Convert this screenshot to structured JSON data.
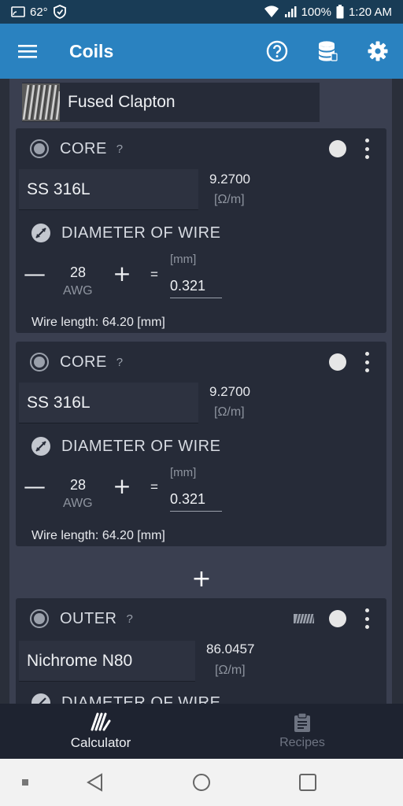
{
  "status_bar": {
    "temperature": "62°",
    "battery": "100%",
    "time": "1:20 AM"
  },
  "app_bar": {
    "title": "Coils",
    "icons": [
      "menu-icon",
      "help-icon",
      "database-icon",
      "settings-icon"
    ]
  },
  "coil": {
    "name": "Fused Clapton"
  },
  "cards": [
    {
      "type": "CORE",
      "help": "?",
      "material": "SS 316L",
      "resistance": "9.2700",
      "resistance_unit": "[Ω/m]",
      "diameter_label": "DIAMETER OF WIRE",
      "minus": "—",
      "gauge": "28",
      "gauge_unit": "AWG",
      "plus": "+",
      "equals": "=",
      "mm_unit": "[mm]",
      "mm_value": "0.321",
      "wire_length": "Wire length: 64.20 [mm]"
    },
    {
      "type": "CORE",
      "help": "?",
      "material": "SS 316L",
      "resistance": "9.2700",
      "resistance_unit": "[Ω/m]",
      "diameter_label": "DIAMETER OF WIRE",
      "minus": "—",
      "gauge": "28",
      "gauge_unit": "AWG",
      "plus": "+",
      "equals": "=",
      "mm_unit": "[mm]",
      "mm_value": "0.321",
      "wire_length": "Wire length: 64.20 [mm]"
    },
    {
      "type": "OUTER",
      "help": "?",
      "material": "Nichrome N80",
      "resistance": "86.0457",
      "resistance_unit": "[Ω/m]",
      "diameter_label": "DIAMETER OF WIRE"
    }
  ],
  "add_button": "+",
  "bottom_nav": {
    "items": [
      {
        "label": "Calculator",
        "icon": "calculator-icon",
        "active": true
      },
      {
        "label": "Recipes",
        "icon": "recipes-icon",
        "active": false
      }
    ]
  },
  "colors": {
    "app_bar": "#2a82c0",
    "status_bar": "#193c56",
    "card_bg": "#262b38",
    "page_bg": "#2a2f3a"
  }
}
